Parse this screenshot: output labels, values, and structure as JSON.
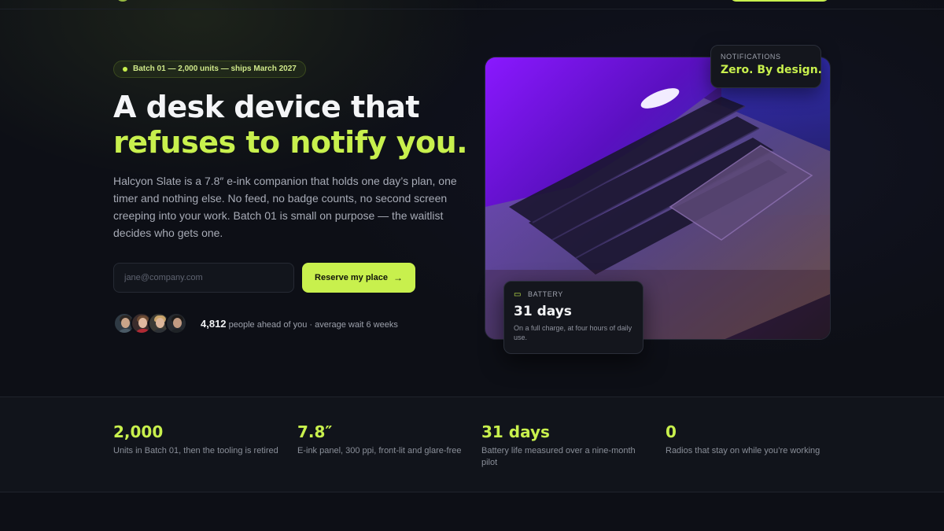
{
  "hero": {
    "badge": "Batch 01 — 2,000 units — ships March 2027",
    "headline_line1": "A desk device that",
    "headline_line2": "refuses to notify you.",
    "lede": "Halcyon Slate is a 7.8″ e-ink companion that holds one day’s plan, one timer and nothing else. No feed, no badge counts, no second screen creeping into your work. Batch 01 is small on purpose — the waitlist decides who gets one.",
    "email_placeholder": "jane@company.com",
    "email_value": "",
    "cta_label": "Reserve my place",
    "cta_icon": "arrow-right-icon",
    "waitlist_count": "4,812",
    "waitlist_text": "people ahead of you · average wait 6 weeks"
  },
  "cards": {
    "notifications": {
      "eyebrow": "NOTIFICATIONS",
      "value": "Zero. By design."
    },
    "battery": {
      "icon": "battery-icon",
      "eyebrow": "BATTERY",
      "value": "31 days",
      "description": "On a full charge, at four hours of daily use."
    }
  },
  "stats": [
    {
      "value": "2,000",
      "label": "Units in Batch 01, then the tooling is retired"
    },
    {
      "value": "7.8″",
      "label": "E-ink panel, 300 ppi, front-lit and glare-free"
    },
    {
      "value": "31 days",
      "label": "Battery life measured over a nine-month pilot"
    },
    {
      "value": "0",
      "label": "Radios that stay on while you’re working"
    }
  ],
  "colors": {
    "accent": "#c8f04d",
    "background": "#0d0f16",
    "surface": "#14161d"
  }
}
